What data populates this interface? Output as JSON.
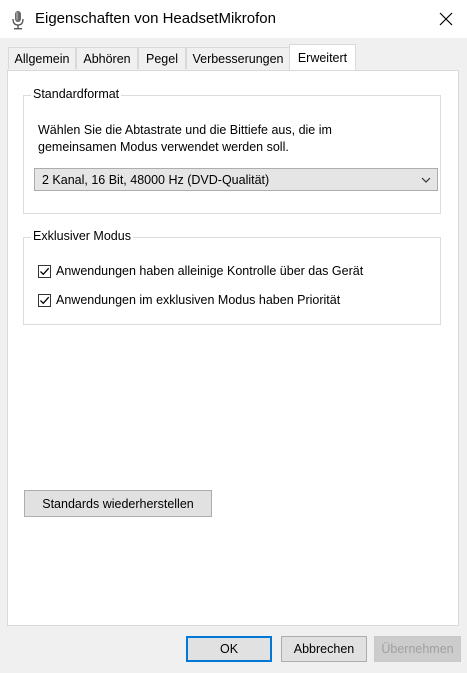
{
  "window": {
    "title": "Eigenschaften von HeadsetMikrofon"
  },
  "icons": {
    "app": "microphone-icon",
    "close": "close-icon",
    "dropdown": "chevron-down-icon",
    "check": "checkmark-icon"
  },
  "tabs": [
    {
      "label": "Allgemein",
      "active": false
    },
    {
      "label": "Abhören",
      "active": false
    },
    {
      "label": "Pegel",
      "active": false
    },
    {
      "label": "Verbesserungen",
      "active": false
    },
    {
      "label": "Erweitert",
      "active": true
    }
  ],
  "standardformat": {
    "title": "Standardformat",
    "description_line1": "Wählen Sie die Abtastrate und die Bittiefe aus, die im",
    "description_line2": "gemeinsamen Modus verwendet werden soll.",
    "selected_value": "2 Kanal, 16 Bit, 48000 Hz (DVD-Qualität)"
  },
  "exclusive_mode": {
    "title": "Exklusiver Modus",
    "options": [
      {
        "label": "Anwendungen haben alleinige Kontrolle über das Gerät",
        "checked": true
      },
      {
        "label": "Anwendungen im exklusiven Modus haben Priorität",
        "checked": true
      }
    ]
  },
  "restore_defaults_label": "Standards wiederherstellen",
  "footer": {
    "ok": "OK",
    "cancel": "Abbrechen",
    "apply": "Übernehmen"
  },
  "colors": {
    "accent": "#0078d7",
    "disabled_text": "#a0a0a0"
  }
}
